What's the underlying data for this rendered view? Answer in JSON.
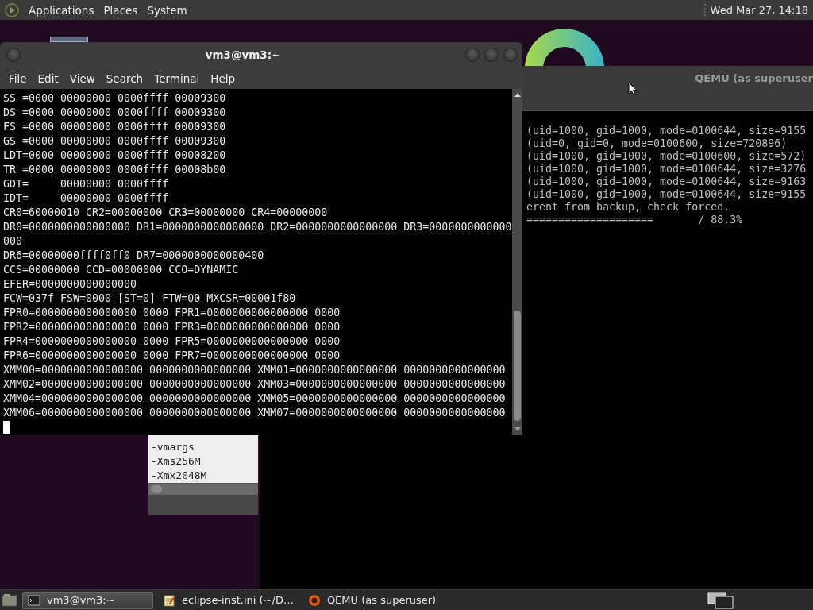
{
  "top_panel": {
    "menus": [
      "Applications",
      "Places",
      "System"
    ],
    "clock": "Wed Mar 27, 14:18"
  },
  "qemu": {
    "title": "QEMU (as superuser",
    "lines": [
      "(uid=1000, gid=1000, mode=0100644, size=9155",
      "(uid=0, gid=0, mode=0100600, size=720896)",
      "(uid=1000, gid=1000, mode=0100600, size=572)",
      "(uid=1000, gid=1000, mode=0100644, size=3276",
      "(uid=1000, gid=1000, mode=0100644, size=9163",
      "(uid=1000, gid=1000, mode=0100644, size=9155",
      "erent from backup, check forced.",
      "====================       / 88.3%"
    ]
  },
  "editor": {
    "lines": [
      "-vmargs",
      "-Xms256M",
      "-Xmx2048M"
    ]
  },
  "terminal": {
    "title": "vm3@vm3:~",
    "menu": [
      "File",
      "Edit",
      "View",
      "Search",
      "Terminal",
      "Help"
    ],
    "lines": [
      "SS =0000 00000000 0000ffff 00009300",
      "DS =0000 00000000 0000ffff 00009300",
      "FS =0000 00000000 0000ffff 00009300",
      "GS =0000 00000000 0000ffff 00009300",
      "LDT=0000 00000000 0000ffff 00008200",
      "TR =0000 00000000 0000ffff 00008b00",
      "GDT=     00000000 0000ffff",
      "IDT=     00000000 0000ffff",
      "CR0=60000010 CR2=00000000 CR3=00000000 CR4=00000000",
      "DR0=0000000000000000 DR1=0000000000000000 DR2=0000000000000000 DR3=0000000000000",
      "000",
      "DR6=00000000ffff0ff0 DR7=0000000000000400",
      "CCS=00000000 CCD=00000000 CCO=DYNAMIC",
      "EFER=0000000000000000",
      "FCW=037f FSW=0000 [ST=0] FTW=00 MXCSR=00001f80",
      "FPR0=0000000000000000 0000 FPR1=0000000000000000 0000",
      "FPR2=0000000000000000 0000 FPR3=0000000000000000 0000",
      "FPR4=0000000000000000 0000 FPR5=0000000000000000 0000",
      "FPR6=0000000000000000 0000 FPR7=0000000000000000 0000",
      "XMM00=0000000000000000 0000000000000000 XMM01=0000000000000000 0000000000000000",
      "XMM02=0000000000000000 0000000000000000 XMM03=0000000000000000 0000000000000000",
      "XMM04=0000000000000000 0000000000000000 XMM05=0000000000000000 0000000000000000",
      "XMM06=0000000000000000 0000000000000000 XMM07=0000000000000000 0000000000000000"
    ]
  },
  "taskbar": {
    "items": [
      {
        "kind": "terminal",
        "label": "vm3@vm3:~",
        "selected": true
      },
      {
        "kind": "editor",
        "label": "eclipse-inst.ini (~/D…",
        "selected": false
      },
      {
        "kind": "qemu",
        "label": "QEMU (as superuser)",
        "selected": false
      }
    ]
  }
}
